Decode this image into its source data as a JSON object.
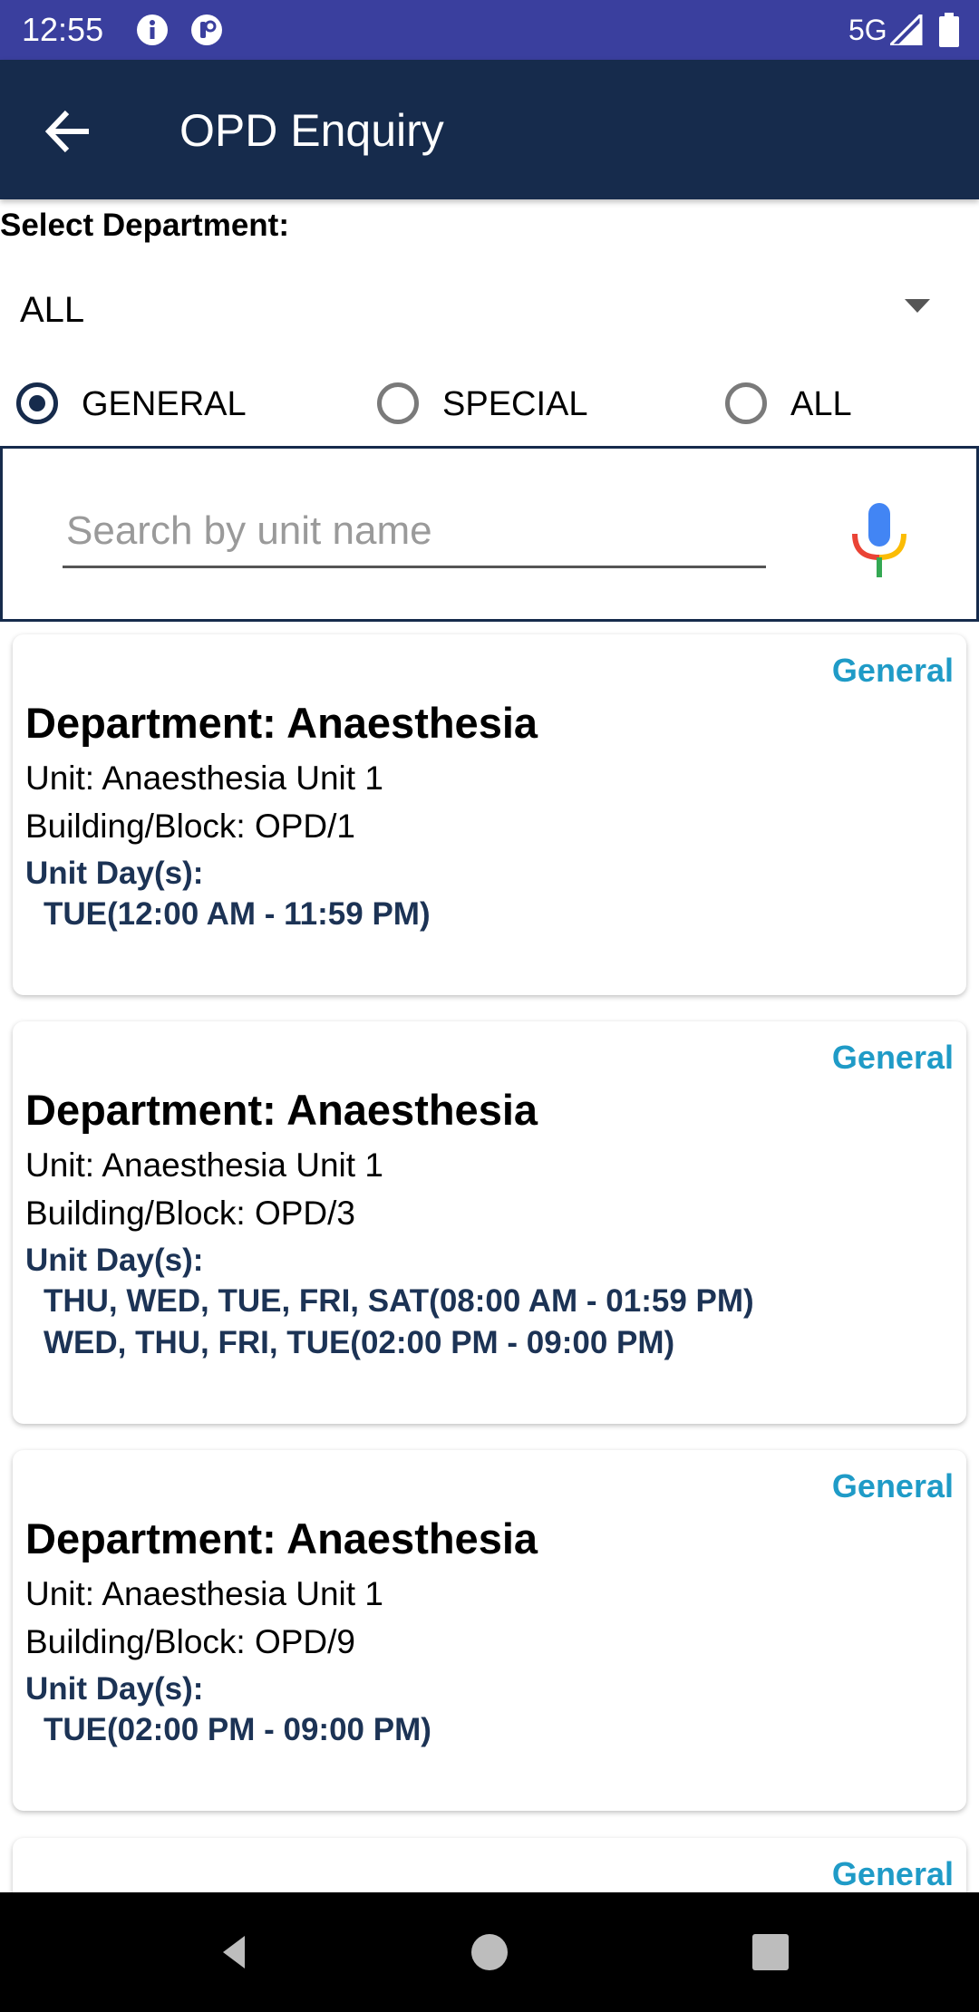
{
  "status_bar": {
    "time": "12:55",
    "network": "5G",
    "icons": [
      "info-icon",
      "notification-app-icon",
      "signal-icon",
      "battery-icon"
    ]
  },
  "app_bar": {
    "title": "OPD Enquiry",
    "back_icon": "arrow-back-icon"
  },
  "filters": {
    "department_label": "Select Department:",
    "department_selected": "ALL",
    "radio_options": [
      {
        "label": "GENERAL",
        "checked": true
      },
      {
        "label": "SPECIAL",
        "checked": false
      },
      {
        "label": "ALL",
        "checked": false
      }
    ]
  },
  "search": {
    "placeholder": "Search by unit name",
    "value": "",
    "mic_icon": "microphone-icon"
  },
  "results": [
    {
      "badge": "General",
      "department": "Department: Anaesthesia",
      "unit": "Unit: Anaesthesia Unit 1",
      "building": "Building/Block:  OPD/1",
      "days_label": "Unit Day(s):",
      "schedule": [
        "TUE(12:00 AM - 11:59 PM)"
      ]
    },
    {
      "badge": "General",
      "department": "Department: Anaesthesia",
      "unit": "Unit: Anaesthesia Unit 1",
      "building": "Building/Block:  OPD/3",
      "days_label": "Unit Day(s):",
      "schedule": [
        "THU, WED, TUE, FRI, SAT(08:00 AM - 01:59 PM)",
        "WED, THU, FRI, TUE(02:00 PM - 09:00 PM)"
      ]
    },
    {
      "badge": "General",
      "department": "Department: Anaesthesia",
      "unit": "Unit: Anaesthesia Unit 1",
      "building": "Building/Block:  OPD/9",
      "days_label": "Unit Day(s):",
      "schedule": [
        "TUE(02:00 PM - 09:00 PM)"
      ]
    },
    {
      "badge": "General"
    }
  ],
  "colors": {
    "status_bar": "#3a3f9e",
    "app_bar": "#162b4c",
    "badge": "#1f9bc7",
    "schedule_text": "#1c3355"
  },
  "nav_bar": {
    "icons": [
      "nav-back-icon",
      "nav-home-icon",
      "nav-recents-icon"
    ]
  }
}
